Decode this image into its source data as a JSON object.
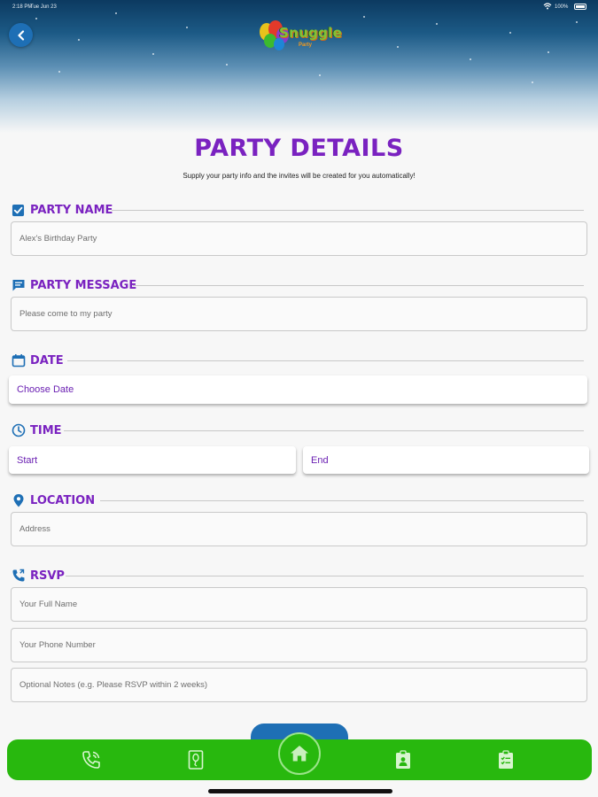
{
  "status_bar": {
    "time": "2:18 PM",
    "date": "Tue Jun 23",
    "battery": "100%"
  },
  "header": {
    "logo_text": "Snuggle",
    "logo_sub": "Party"
  },
  "page": {
    "title": "PARTY DETAILS",
    "subtitle": "Supply your party info and the invites will be created for you automatically!"
  },
  "sections": {
    "party_name": {
      "label": "PARTY NAME",
      "icon": "checkbox-icon",
      "value": "Alex's Birthday Party"
    },
    "party_message": {
      "label": "PARTY MESSAGE",
      "icon": "message-icon",
      "value": "Please come to my party"
    },
    "date": {
      "label": "DATE",
      "icon": "calendar-icon",
      "value": "Choose Date"
    },
    "time": {
      "label": "TIME",
      "icon": "clock-icon",
      "start": "Start",
      "end": "End"
    },
    "location": {
      "label": "LOCATION",
      "icon": "location-pin-icon",
      "placeholder": "Address"
    },
    "rsvp": {
      "label": "RSVP",
      "icon": "phone-icon",
      "name_placeholder": "Your Full Name",
      "phone_placeholder": "Your Phone Number",
      "notes_placeholder": "Optional Notes (e.g. Please RSVP within 2 weeks)"
    }
  },
  "tabbar": {
    "items": [
      "phone-tab-icon",
      "invite-card-icon",
      "home-icon",
      "badge-icon",
      "checklist-icon"
    ]
  },
  "colors": {
    "accent_purple": "#7a22c0",
    "icon_blue": "#1e6fb5",
    "tabbar_green": "#28b80e"
  }
}
